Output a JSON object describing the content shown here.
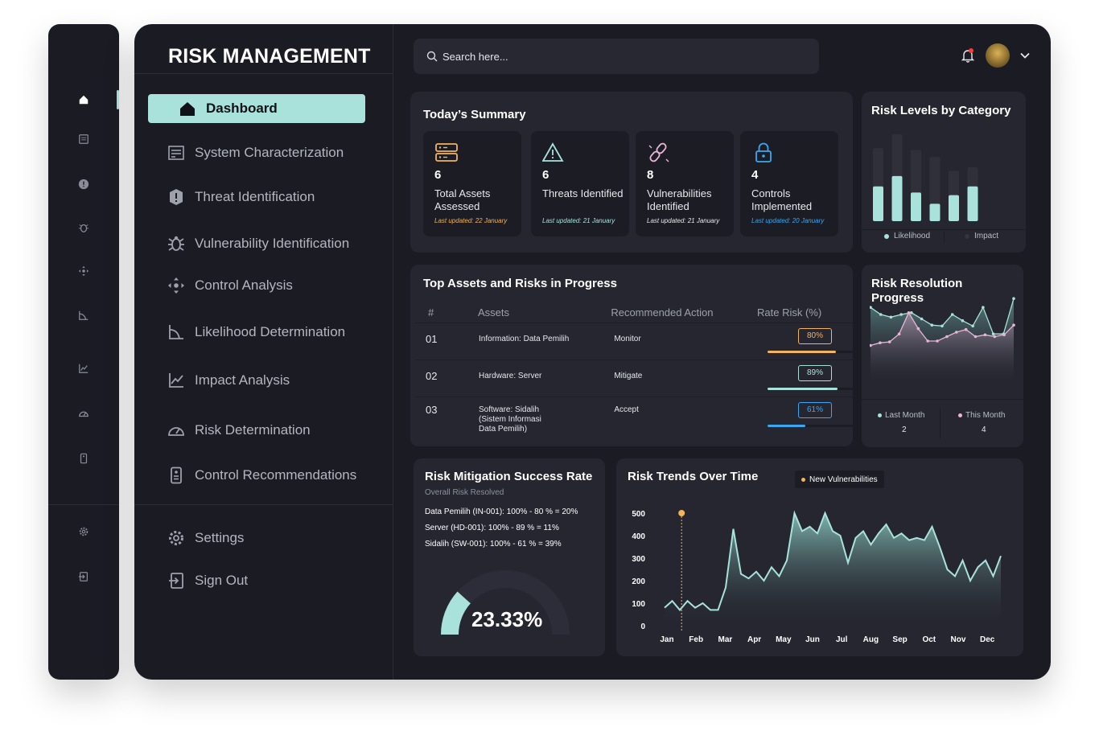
{
  "brand": "RISK MANAGEMENT",
  "search": {
    "placeholder": "Search here..."
  },
  "rail_icons": [
    "home-icon",
    "list-icon",
    "alert-icon",
    "bug-icon",
    "control-icon",
    "likelihood-icon",
    "chart-icon",
    "gauge-icon",
    "remote-icon",
    "settings-icon",
    "sign-out-icon"
  ],
  "nav": [
    {
      "label": "Dashboard",
      "icon": "home-icon",
      "active": true
    },
    {
      "label": "System Characterization",
      "icon": "system-icon"
    },
    {
      "label": "Threat Identification",
      "icon": "alert-icon"
    },
    {
      "label": "Vulnerability Identification",
      "icon": "bug-icon"
    },
    {
      "label": "Control Analysis",
      "icon": "control-icon"
    },
    {
      "label": "Likelihood Determination",
      "icon": "likelihood-icon"
    },
    {
      "label": "Impact Analysis",
      "icon": "chart-icon"
    },
    {
      "label": "Risk Determination",
      "icon": "gauge-icon"
    },
    {
      "label": "Control Recommendations",
      "icon": "remote-icon"
    }
  ],
  "bottom_nav": [
    {
      "label": "Settings",
      "icon": "settings-icon"
    },
    {
      "label": "Sign Out",
      "icon": "sign-out-icon"
    }
  ],
  "summary": {
    "title": "Today’s Summary",
    "stats": [
      {
        "value": "6",
        "label": "Total Assets Assessed",
        "updated": "Last updated: 22 January",
        "color": "#f2b45c",
        "icon": "server-icon"
      },
      {
        "value": "6",
        "label": "Threats Identified",
        "updated": "Last updated: 21 January",
        "color": "#a9e2da",
        "icon": "warning-icon"
      },
      {
        "value": "8",
        "label": "Vulnerabilities Identified",
        "updated": "Last updated: 21 January",
        "color": "#e8b4d8",
        "icon": "broken-link-icon"
      },
      {
        "value": "4",
        "label": "Controls Implemented",
        "updated": "Last updated: 20 January",
        "color": "#3aa8f0",
        "icon": "lock-icon"
      }
    ]
  },
  "risk_levels": {
    "title": "Risk Levels by Category",
    "legend_likelihood": "Likelihood",
    "legend_impact": "Impact",
    "colors": {
      "likelihood": "#a9e2da",
      "impact": "#2f303a"
    }
  },
  "top_assets": {
    "title": "Top Assets and Risks in Progress",
    "headers": [
      "#",
      "Assets",
      "Recommended Action",
      "Rate Risk (%)"
    ],
    "rows": [
      {
        "no": "01",
        "asset": "Information: Data Pemilih",
        "action": "Monitor",
        "rate": "80%",
        "color": "#f2b45c"
      },
      {
        "no": "02",
        "asset": "Hardware: Server",
        "action": "Mitigate",
        "rate": "89%",
        "color": "#a9e2da"
      },
      {
        "no": "03",
        "asset": "Software: Sidalih (Sistem Informasi Data Pemilih)",
        "action": "Accept",
        "rate": "61%",
        "color": "#3aa8f0"
      }
    ]
  },
  "resolution": {
    "title": "Risk Resolution Progress",
    "last_month_label": "Last Month",
    "last_month_value": "2",
    "this_month_label": "This Month",
    "this_month_value": "4"
  },
  "mitigation": {
    "title": "Risk Mitigation Success Rate",
    "subtitle": "Overall Risk Resolved",
    "lines": [
      "Data Pemilih (IN-001): 100% - 80 % = 20%",
      "Server (HD-001): 100% - 89 % = 11%",
      "Sidalih (SW-001): 100% - 61 % = 39%"
    ],
    "value": "23.33%"
  },
  "trends": {
    "title": "Risk Trends Over Time",
    "legend": "New Vulnerabilities"
  },
  "chart_data": [
    {
      "type": "bar",
      "title": "Risk Levels by Category",
      "series": [
        {
          "name": "Likelihood",
          "values": [
            40,
            52,
            33,
            20,
            30,
            40
          ]
        },
        {
          "name": "Impact",
          "values": [
            84,
            100,
            82,
            74,
            58,
            62
          ]
        }
      ],
      "legend": "bottom"
    },
    {
      "type": "area",
      "title": "Risk Resolution Progress",
      "series": [
        {
          "name": "Last Month",
          "values": [
            88,
            80,
            77,
            80,
            82,
            75,
            68,
            67,
            80,
            73,
            67,
            88,
            58,
            58,
            98
          ]
        },
        {
          "name": "This Month",
          "values": [
            45,
            48,
            49,
            58,
            82,
            64,
            50,
            50,
            55,
            60,
            63,
            55,
            57,
            55,
            57,
            68
          ]
        }
      ],
      "legend": "bottom"
    },
    {
      "type": "area",
      "title": "Risk Trends Over Time",
      "categories": [
        "Jan",
        "Feb",
        "Mar",
        "Apr",
        "May",
        "Jun",
        "Jul",
        "Aug",
        "Sep",
        "Oct",
        "Nov",
        "Dec"
      ],
      "yticks": [
        0,
        100,
        200,
        300,
        400,
        500
      ],
      "ylim": [
        0,
        500
      ],
      "series": [
        {
          "name": "New Vulnerabilities",
          "values": [
            80,
            110,
            70,
            110,
            80,
            100,
            70,
            70,
            170,
            430,
            230,
            210,
            240,
            200,
            260,
            220,
            290,
            500,
            420,
            440,
            410,
            500,
            420,
            400,
            280,
            390,
            420,
            360,
            410,
            450,
            390,
            410,
            380,
            390,
            380,
            440,
            350,
            250,
            220,
            290,
            200,
            260,
            290,
            220,
            310
          ]
        }
      ],
      "marker": {
        "x": "Feb",
        "y": 500
      },
      "legend": "top"
    },
    {
      "type": "gauge",
      "title": "Risk Mitigation Success Rate",
      "value": 23.33,
      "unit": "%"
    }
  ]
}
